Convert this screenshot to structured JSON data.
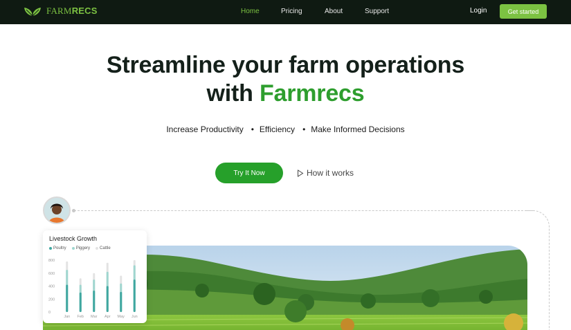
{
  "brand": {
    "name_part1": "FARM",
    "name_part2": "RECS"
  },
  "nav": {
    "links": [
      "Home",
      "Pricing",
      "About",
      "Support"
    ],
    "active": "Home",
    "login": "Login",
    "cta": "Get started"
  },
  "hero": {
    "title_line1": "Streamline your farm operations",
    "title_line2_prefix": "with ",
    "title_line2_highlight": "Farmrecs",
    "bullets": [
      "Increase Productivity",
      "Efficiency",
      "Make Informed Decisions"
    ],
    "primary_button": "Try It Now",
    "secondary_button": "How it works"
  },
  "card": {
    "title": "Livestock Growth",
    "legend": [
      {
        "name": "Poultry",
        "color": "#3fa7a0"
      },
      {
        "name": "Piggery",
        "color": "#9fd6cf"
      },
      {
        "name": "Cattle",
        "color": "#e3e3e3"
      }
    ]
  },
  "chart_data": {
    "type": "bar",
    "title": "Livestock Growth",
    "categories": [
      "Jan",
      "Feb",
      "Mar",
      "Apr",
      "May",
      "Jun"
    ],
    "yticks": [
      0,
      200,
      400,
      600,
      800
    ],
    "ylim": [
      0,
      800
    ],
    "series": [
      {
        "name": "Poultry",
        "values": [
          420,
          300,
          330,
          400,
          310,
          500
        ]
      },
      {
        "name": "Piggery",
        "values": [
          650,
          420,
          500,
          620,
          440,
          720
        ]
      },
      {
        "name": "Cattle",
        "values": [
          780,
          520,
          600,
          760,
          560,
          800
        ]
      }
    ],
    "colors": [
      "#3fa7a0",
      "#9fd6cf",
      "#e3e3e3"
    ],
    "legend": "top-left",
    "grid": false
  },
  "colors": {
    "nav_bg": "#0f1a12",
    "accent": "#7cc242",
    "primary_green": "#26a02a",
    "highlight_green": "#2e9e2e"
  }
}
